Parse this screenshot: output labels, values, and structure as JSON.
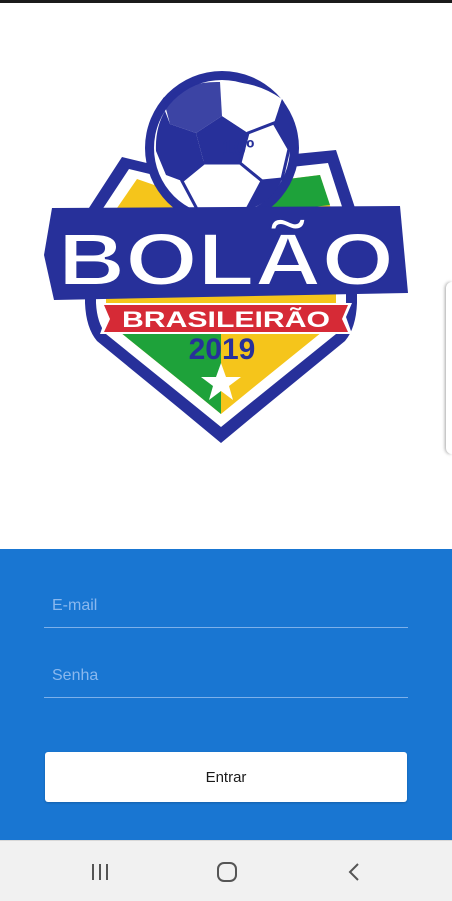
{
  "logo": {
    "edition": "10º",
    "title": "BOLÃO",
    "banner": "BRASILEIRÃO",
    "year": "2019"
  },
  "login": {
    "email_placeholder": "E-mail",
    "password_placeholder": "Senha",
    "submit_label": "Entrar"
  },
  "navigation": {
    "recents": "recents-icon",
    "home": "home-icon",
    "back": "back-icon"
  },
  "colors": {
    "primary_blue": "#1976d2",
    "logo_navy": "#27309a",
    "logo_green": "#1ea23a",
    "logo_yellow": "#f5c51b",
    "logo_red": "#d62a36",
    "nav_bar": "#f1f1f1"
  }
}
